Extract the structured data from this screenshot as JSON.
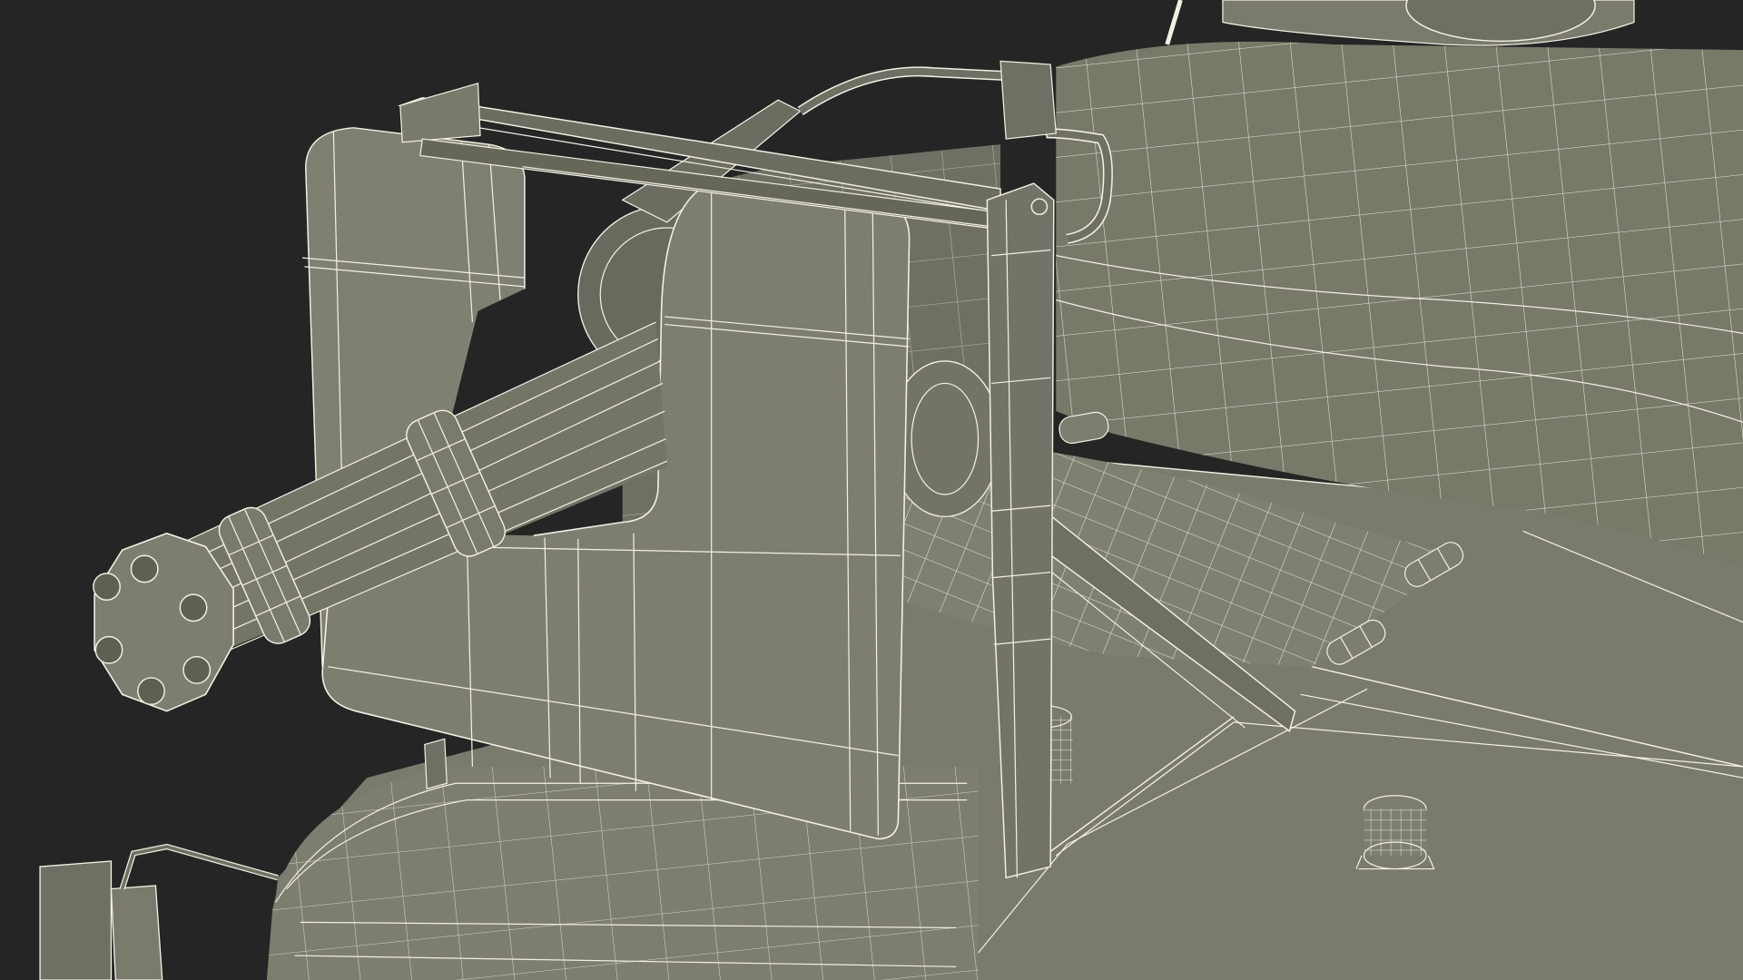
{
  "scene": {
    "subject": "minigun-turret-wireframe-render",
    "background_color": "#252525",
    "surface_color": "#7a7b6c",
    "surface_dark_color": "#5f6054",
    "surface_light_color": "#8a8b7b",
    "wire_color": "#f2f0e4"
  }
}
